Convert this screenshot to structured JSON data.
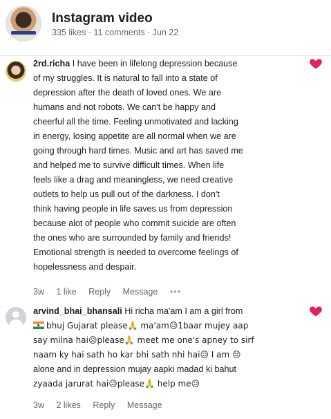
{
  "post": {
    "title": "Instagram video",
    "likes": "335 likes",
    "comments": "11 comments",
    "date": "Jun 22",
    "separator": " · "
  },
  "comments": [
    {
      "author": "2rd.richa",
      "lines": [
        "I have been in lifelong depression because",
        "of my struggles. It is natural to fall into a state of",
        "depression after the death of loved ones. We are",
        "humans and not robots. We can't be happy and",
        "cheerful all the time. Feeling unmotivated and lacking",
        "in energy, losing appetite are all normal when we are",
        "going through hard times. Music and art has saved me",
        "and helped me to survive difficult times. When life",
        "feels like a drag and meaningless, we need creative",
        "outlets to help us pull out of the darkness. I don't",
        "think having people in life saves us from depression",
        "because alot of people who commit suicide are often",
        "the ones who are surrounded by family and friends!",
        "Emotional strength is needed to overcome feelings of",
        "hopelessness and despair."
      ],
      "time": "3w",
      "likes": "1 like",
      "reply": "Reply",
      "message": "Message",
      "more": "•••",
      "reaction_icon": "heart-icon",
      "reaction_color": "#e0245e"
    },
    {
      "author": "arvind_bhai_bhansali",
      "lines": [
        "Hi richa ma'am I am a girl from",
        "bhuj Gujarat please🙏 ma'am😥1baar mujey aap",
        "say milna hai😥please🙏 meet me one's apney to sirf",
        "naam ky hai sath ho kar bhi sath nhi hai😥 I am 😔",
        "alone and in depression mujay aapki madad ki bahut",
        "zyaada jarurat hai😥please🙏 help me😥"
      ],
      "time": "3w",
      "likes": "2 likes",
      "reply": "Reply",
      "message": "Message",
      "more": "•••",
      "reaction_icon": "heart-icon",
      "reaction_color": "#e0245e"
    }
  ]
}
